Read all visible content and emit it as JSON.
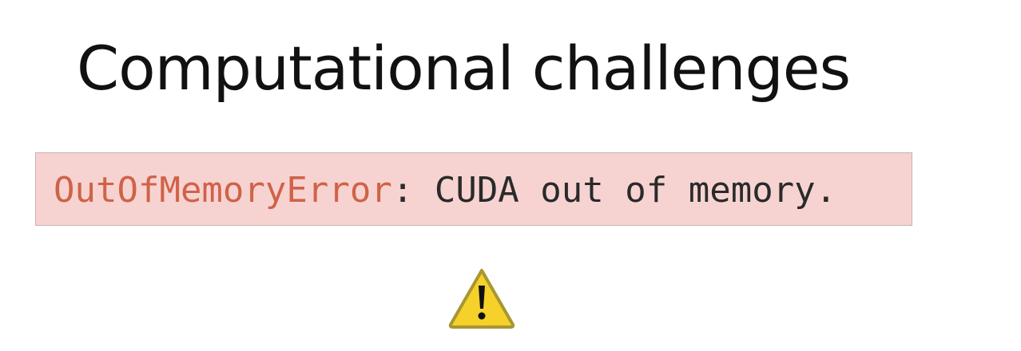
{
  "slide": {
    "title": "Computational challenges",
    "error": {
      "type": "OutOfMemoryError",
      "separator": ":",
      "message": " CUDA out of memory."
    },
    "icon": "warning-icon",
    "colors": {
      "error_type": "#d06248",
      "error_background": "#f6d3d1",
      "warning_fill": "#f6d12a"
    }
  }
}
